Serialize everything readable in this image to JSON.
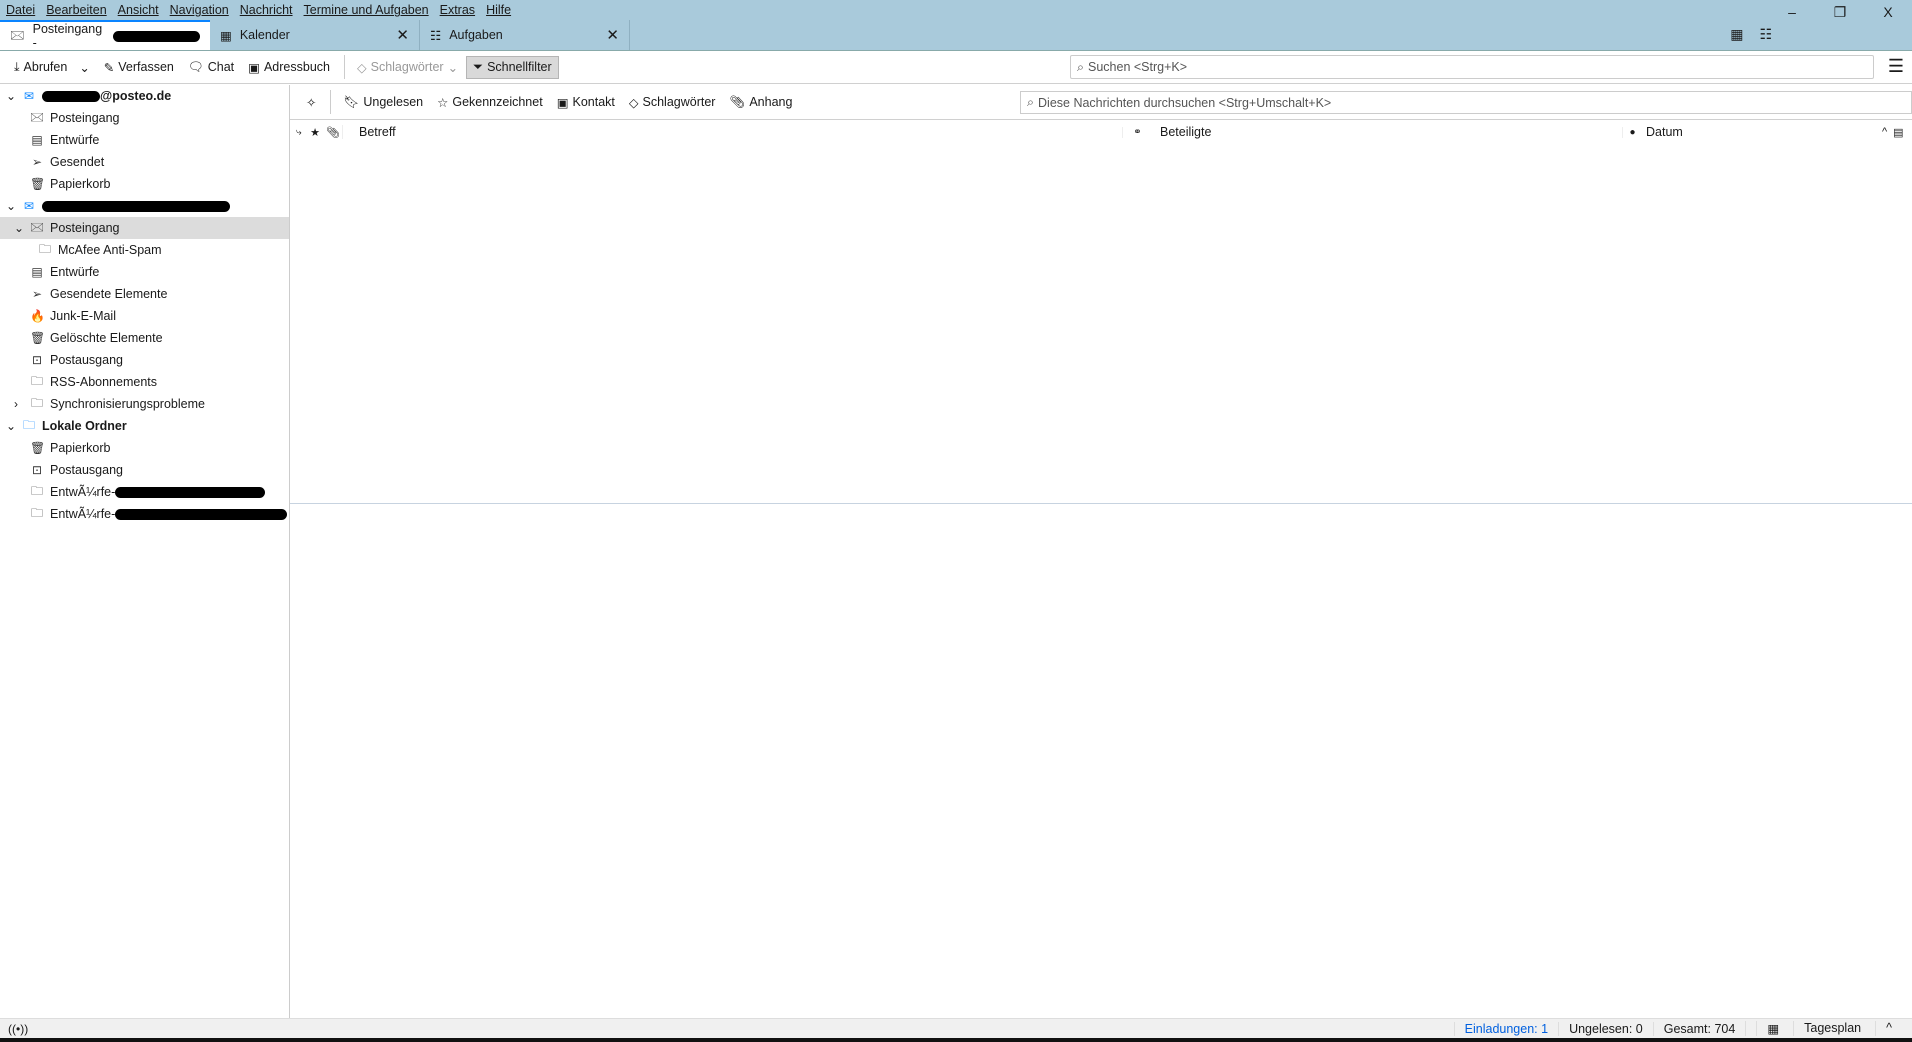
{
  "menu": [
    "Datei",
    "Bearbeiten",
    "Ansicht",
    "Navigation",
    "Nachricht",
    "Termine und Aufgaben",
    "Extras",
    "Hilfe"
  ],
  "window_controls": {
    "minimize": "–",
    "restore": "❐",
    "close": "X"
  },
  "tabs": [
    {
      "label": "Posteingang - "
    },
    {
      "label": "Kalender",
      "close": "✕"
    },
    {
      "label": "Aufgaben",
      "close": "✕"
    }
  ],
  "toolbar": {
    "get": "Abrufen",
    "write": "Verfassen",
    "chat": "Chat",
    "addressbook": "Adressbuch",
    "tags": "Schlagwörter",
    "quickfilter": "Schnellfilter",
    "search_placeholder": "Suchen <Strg+K>"
  },
  "folders": {
    "account1": {
      "name": "@posteo.de",
      "items": [
        "Posteingang",
        "Entwürfe",
        "Gesendet",
        "Papierkorb"
      ]
    },
    "account2": {
      "items": [
        "Posteingang",
        "McAfee Anti-Spam",
        "Entwürfe",
        "Gesendete Elemente",
        "Junk-E-Mail",
        "Gelöschte Elemente",
        "Postausgang",
        "RSS-Abonnements",
        "Synchronisierungsprobleme"
      ]
    },
    "local": {
      "name": "Lokale Ordner",
      "items": [
        "Papierkorb",
        "Postausgang",
        "EntwÃ¼rfe-",
        "EntwÃ¼rfe-"
      ]
    }
  },
  "quickfilter": {
    "unread": "Ungelesen",
    "starred": "Gekennzeichnet",
    "contact": "Kontakt",
    "tags": "Schlagwörter",
    "attachment": "Anhang",
    "search_placeholder": "Diese Nachrichten durchsuchen <Strg+Umschalt+K>"
  },
  "columns": {
    "subject": "Betreff",
    "participants": "Beteiligte",
    "date": "Datum"
  },
  "status": {
    "invitations": "Einladungen: 1",
    "unread": "Ungelesen: 0",
    "total": "Gesamt: 704",
    "today": "Tagesplan"
  },
  "colors": {
    "titlebar": "#a9cadb",
    "accent": "#0a84ff",
    "link": "#0060df"
  }
}
